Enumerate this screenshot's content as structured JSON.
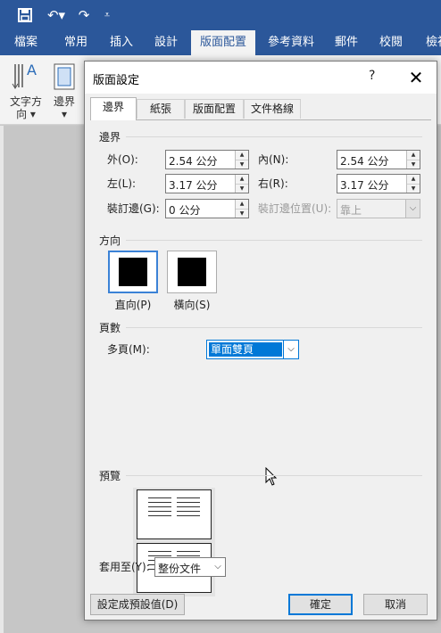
{
  "qat": {
    "save_icon": "save-icon",
    "undo_icon": "undo-icon",
    "redo_icon": "redo-icon",
    "customize_icon": "customize-qat-icon"
  },
  "ribbon_tabs": [
    "檔案",
    "常用",
    "插入",
    "設計",
    "版面配置",
    "參考資料",
    "郵件",
    "校閱",
    "檢視"
  ],
  "ribbon_groups": {
    "text_direction_line1": "文字方",
    "text_direction_line2": "向",
    "margins": "邊界"
  },
  "dialog": {
    "title": "版面設定",
    "help": "?",
    "tabs": [
      "邊界",
      "紙張",
      "版面配置",
      "文件格線"
    ],
    "margins_section": "邊界",
    "fields": {
      "outside_label": "外(O):",
      "outside_value": "2.54 公分",
      "inside_label": "內(N):",
      "inside_value": "2.54 公分",
      "left_label": "左(L):",
      "left_value": "3.17 公分",
      "right_label": "右(R):",
      "right_value": "3.17 公分",
      "gutter_label": "裝訂邊(G):",
      "gutter_value": "0 公分",
      "gutter_pos_label": "裝訂邊位置(U):",
      "gutter_pos_value": "靠上"
    },
    "orientation_section": "方向",
    "portrait_label": "直向(P)",
    "landscape_label": "橫向(S)",
    "pages_section": "頁數",
    "multiple_pages_label": "多頁(M):",
    "multiple_pages_value": "單面雙頁",
    "preview_section": "預覽",
    "apply_to_label": "套用至(Y):",
    "apply_to_value": "整份文件",
    "set_default_button": "設定成預設值(D)",
    "ok_button": "確定",
    "cancel_button": "取消"
  },
  "colors": {
    "word_blue": "#2b579a",
    "accent": "#0078d7"
  }
}
